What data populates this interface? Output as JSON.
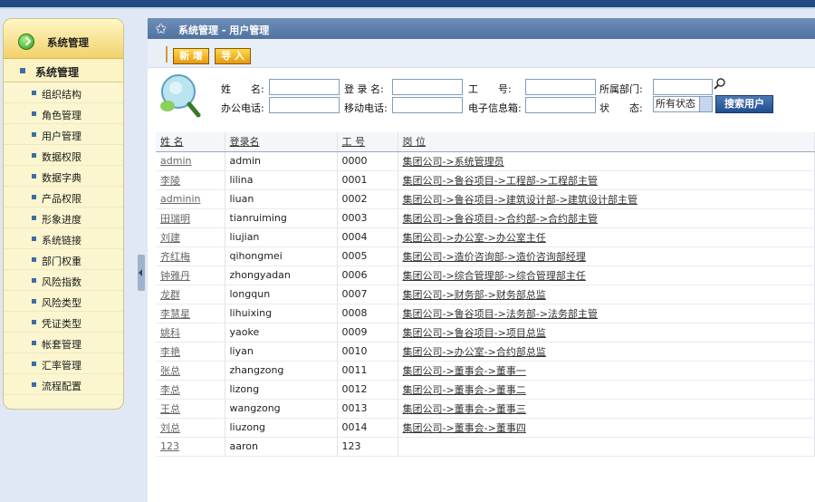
{
  "sidebar": {
    "title": "系统管理",
    "section": "系统管理",
    "items": [
      {
        "label": "组织结构"
      },
      {
        "label": "角色管理"
      },
      {
        "label": "用户管理"
      },
      {
        "label": "数据权限"
      },
      {
        "label": "数据字典"
      },
      {
        "label": "产品权限"
      },
      {
        "label": "形象进度"
      },
      {
        "label": "系统链接"
      },
      {
        "label": "部门权重"
      },
      {
        "label": "风险指数"
      },
      {
        "label": "风险类型"
      },
      {
        "label": "凭证类型"
      },
      {
        "label": "帐套管理"
      },
      {
        "label": "汇率管理"
      },
      {
        "label": "流程配置"
      }
    ]
  },
  "main": {
    "title": "系统管理 - 用户管理",
    "toolbar": {
      "new_label": "新 增",
      "import_label": "导 入"
    },
    "search": {
      "name_label": "姓　　名:",
      "login_label": "登 录 名:",
      "workno_label": "工　　号:",
      "dept_label": "所属部门:",
      "phone_label": "办公电话:",
      "mobile_label": "移动电话:",
      "email_label": "电子信息箱:",
      "status_label": "状　　态:",
      "status_value": "所有状态",
      "search_button": "搜索用户"
    },
    "table": {
      "headers": [
        "姓 名",
        "登录名",
        "工 号",
        "岗 位"
      ],
      "rows": [
        {
          "name": "admin",
          "login": "admin",
          "no": "0000",
          "post": "集团公司->系统管理员"
        },
        {
          "name": "李陵",
          "login": "lilina",
          "no": "0001",
          "post": "集团公司->鲁谷项目->工程部->工程部主管"
        },
        {
          "name": "adminin",
          "login": "liuan",
          "no": "0002",
          "post": "集团公司->鲁谷项目->建筑设计部->建筑设计部主管"
        },
        {
          "name": "田瑞明",
          "login": "tianruiming",
          "no": "0003",
          "post": "集团公司->鲁谷项目->合约部->合约部主管"
        },
        {
          "name": "刘建",
          "login": "liujian",
          "no": "0004",
          "post": "集团公司->办公室->办公室主任"
        },
        {
          "name": "齐红梅",
          "login": "qihongmei",
          "no": "0005",
          "post": "集团公司->造价咨询部->造价咨询部经理"
        },
        {
          "name": "钟雅丹",
          "login": "zhongyadan",
          "no": "0006",
          "post": "集团公司->综合管理部->综合管理部主任"
        },
        {
          "name": "龙群",
          "login": "longqun",
          "no": "0007",
          "post": "集团公司->财务部->财务部总监"
        },
        {
          "name": "李慧星",
          "login": "lihuixing",
          "no": "0008",
          "post": "集团公司->鲁谷项目->法务部->法务部主管"
        },
        {
          "name": "姚科",
          "login": "yaoke",
          "no": "0009",
          "post": "集团公司->鲁谷项目->项目总监"
        },
        {
          "name": "李艳",
          "login": "liyan",
          "no": "0010",
          "post": "集团公司->办公室->合约部总监"
        },
        {
          "name": "张总",
          "login": "zhangzong",
          "no": "0011",
          "post": "集团公司->董事会->董事一"
        },
        {
          "name": "李总",
          "login": "lizong",
          "no": "0012",
          "post": "集团公司->董事会->董事二"
        },
        {
          "name": "王总",
          "login": "wangzong",
          "no": "0013",
          "post": "集团公司->董事会->董事三"
        },
        {
          "name": "刘总",
          "login": "liuzong",
          "no": "0014",
          "post": "集团公司->董事会->董事四"
        },
        {
          "name": "123",
          "login": "aaron",
          "no": "123",
          "post": ""
        }
      ]
    }
  },
  "colors": {
    "accent": "#4f72a0",
    "button_orange": "#e89a10",
    "sidebar_bg": "#fbf6d0"
  }
}
